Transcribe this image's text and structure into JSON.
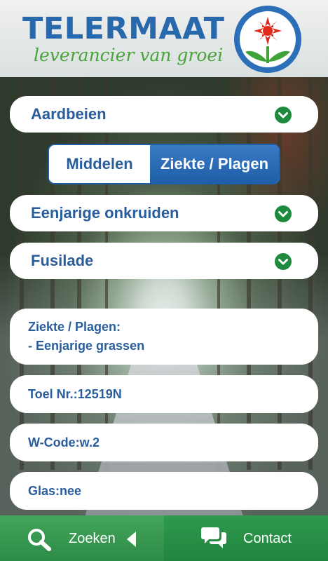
{
  "header": {
    "brand": "TELERMAAT",
    "tagline": "leverancier van groei",
    "logo_icon": "flower-sun-logo-icon"
  },
  "crop_dropdown": {
    "label": "Aardbeien",
    "icon": "chevron-down-icon"
  },
  "segment": {
    "options": [
      {
        "label": "Middelen",
        "selected": false
      },
      {
        "label": "Ziekte / Plagen",
        "selected": true
      }
    ]
  },
  "pest_dropdown": {
    "label": "Eenjarige onkruiden",
    "icon": "chevron-down-icon"
  },
  "product_dropdown": {
    "label": "Fusilade",
    "icon": "chevron-down-icon"
  },
  "details": {
    "disease_title": "Ziekte / Plagen:",
    "disease_value": "- Eenjarige grassen",
    "toel_nr": "Toel Nr.:12519N",
    "w_code": "W-Code:w.2",
    "glas": "Glas:nee"
  },
  "footer": {
    "search_label": "Zoeken",
    "contact_label": "Contact"
  },
  "colors": {
    "brand_blue": "#2a5d9c",
    "brand_green": "#2d8c47",
    "chevron_green": "#1e8a3e"
  }
}
